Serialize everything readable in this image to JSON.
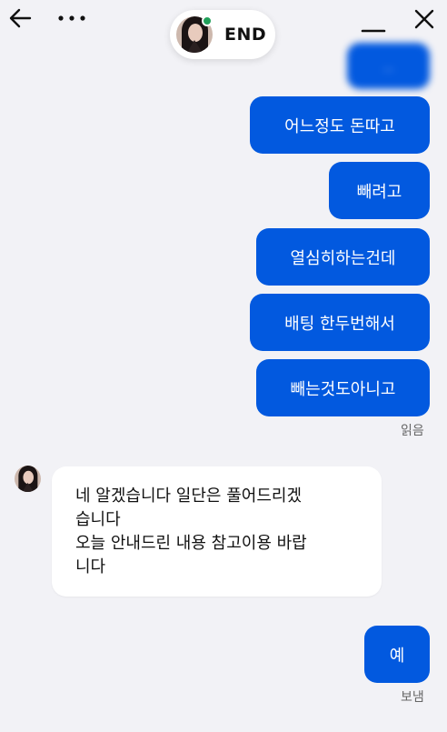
{
  "header": {
    "contact_status": "END"
  },
  "messages": [
    {
      "text": "어느정도 돈따고",
      "status": ""
    },
    {
      "text": "빼려고",
      "status": ""
    },
    {
      "text": "열심히하는건데",
      "status": ""
    },
    {
      "text": "배팅 한두번해서",
      "status": ""
    },
    {
      "text": "빼는것도아니고",
      "status": "읽음"
    }
  ],
  "incoming": {
    "text": "네 알겠습니다 일단은 풀어드리겠\n습니다\n오늘 안내드린 내용 참고이용 바랍\n니다"
  },
  "reply": {
    "text": "예",
    "status": "보냄"
  },
  "colors": {
    "bubble_out": "#0259df",
    "background": "#f2f2f6",
    "online": "#21a05a"
  }
}
